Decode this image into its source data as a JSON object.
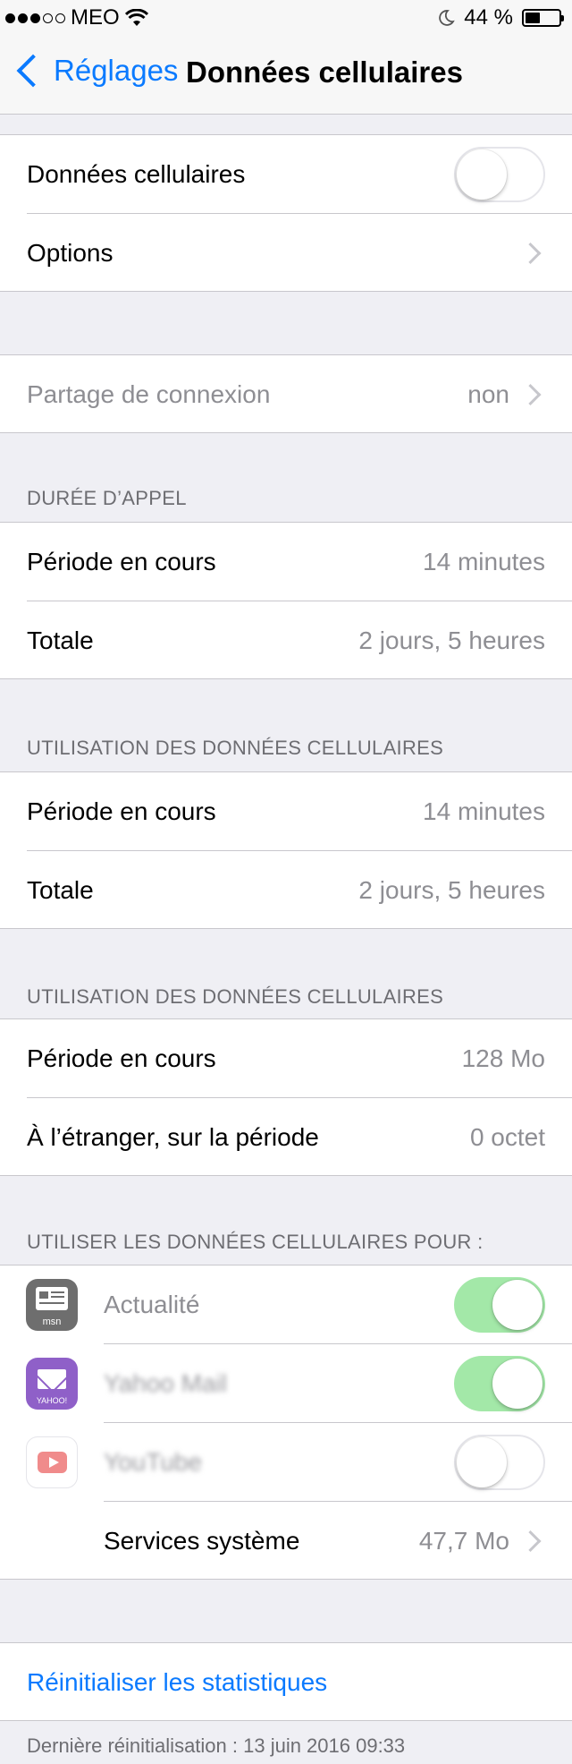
{
  "status_bar": {
    "carrier": "MEO",
    "battery": "44 %",
    "battery_level": 0.44
  },
  "nav": {
    "back_label": "Réglages",
    "title": "Données cellulaires"
  },
  "section1": {
    "cellular_label": "Données cellulaires",
    "cellular_on": false,
    "options_label": "Options"
  },
  "hotspot": {
    "label": "Partage de connexion",
    "value": "non"
  },
  "call_time": {
    "header": "DURÉE D’APPEL",
    "rows": [
      {
        "label": "Période en cours",
        "value": "14 minutes"
      },
      {
        "label": "Totale",
        "value": "2 jours, 5 heures"
      }
    ]
  },
  "cell_usage_1": {
    "header": "UTILISATION DES DONNÉES CELLULAIRES",
    "rows": [
      {
        "label": "Période en cours",
        "value": "14 minutes"
      },
      {
        "label": "Totale",
        "value": "2 jours, 5 heures"
      }
    ]
  },
  "cell_usage_2": {
    "header": "UTILISATION DES DONNÉES CELLULAIRES",
    "rows": [
      {
        "label": "Période en cours",
        "value": "128 Mo"
      },
      {
        "label": "À l’étranger, sur la période",
        "value": "0 octet"
      }
    ]
  },
  "apps": {
    "header": "UTILISER LES DONNÉES CELLULAIRES POUR :",
    "items": [
      {
        "label": "Actualité",
        "icon": "msn-news-icon",
        "icon_text": "msn",
        "enabled": true
      },
      {
        "label": "Yahoo Mail",
        "icon": "yahoo-mail-icon",
        "icon_text": "YAHOO!",
        "enabled": true
      },
      {
        "label": "YouTube",
        "icon": "youtube-icon",
        "enabled": false
      }
    ],
    "system_services": {
      "label": "Services système",
      "value": "47,7 Mo"
    }
  },
  "reset": {
    "label": "Réinitialiser les statistiques",
    "last_reset": "Dernière réinitialisation : 13 juin 2016 09:33"
  },
  "colors": {
    "accent": "#0a7aff",
    "toggle_on": "#a3e8a8",
    "background": "#efeff4"
  }
}
